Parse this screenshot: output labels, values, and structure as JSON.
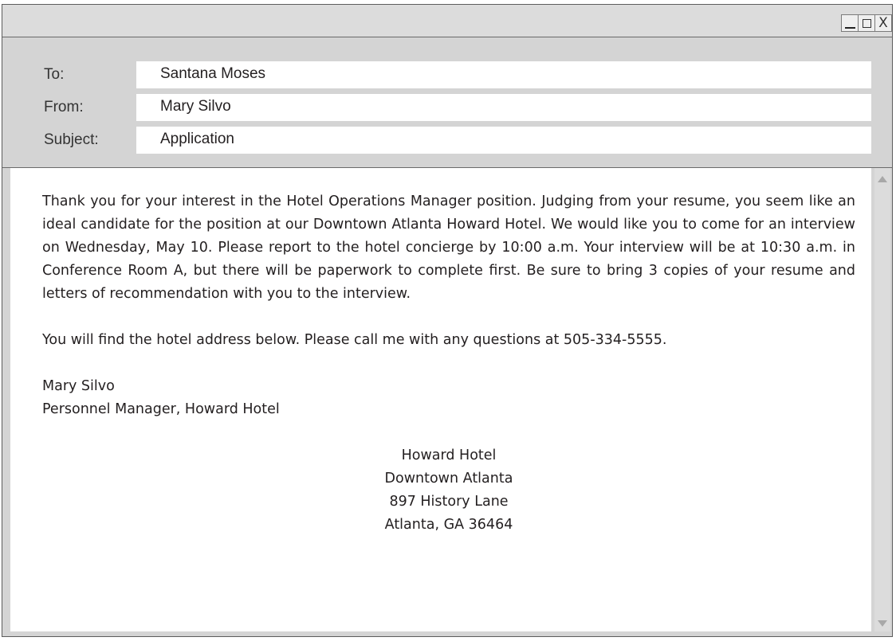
{
  "window": {
    "controls": {
      "minimize": "_",
      "maximize": "□",
      "close": "X"
    }
  },
  "header": {
    "to_label": "To:",
    "to_value": "Santana Moses",
    "from_label": "From:",
    "from_value": "Mary Silvo",
    "subject_label": "Subject:",
    "subject_value": "Application"
  },
  "body": {
    "paragraph1": "Thank you for your interest in the Hotel Operations Manager position. Judging from your resume, you seem like an ideal candidate for the position at our Downtown Atlanta Howard Hotel. We would like you to come for an interview on Wednesday, May 10. Please report to the hotel concierge by 10:00 a.m. Your interview will be at 10:30 a.m. in Conference Room A, but there will be paperwork to complete first. Be sure to bring 3 copies of your resume and letters of recommendation with you to the interview.",
    "paragraph2": "You will find the hotel address below. Please call me with any questions at 505-334-5555.",
    "signature_name": "Mary Silvo",
    "signature_title": "Personnel Manager, Howard Hotel",
    "address": {
      "line1": "Howard Hotel",
      "line2": "Downtown Atlanta",
      "line3": "897 History Lane",
      "line4": "Atlanta, GA 36464"
    }
  }
}
